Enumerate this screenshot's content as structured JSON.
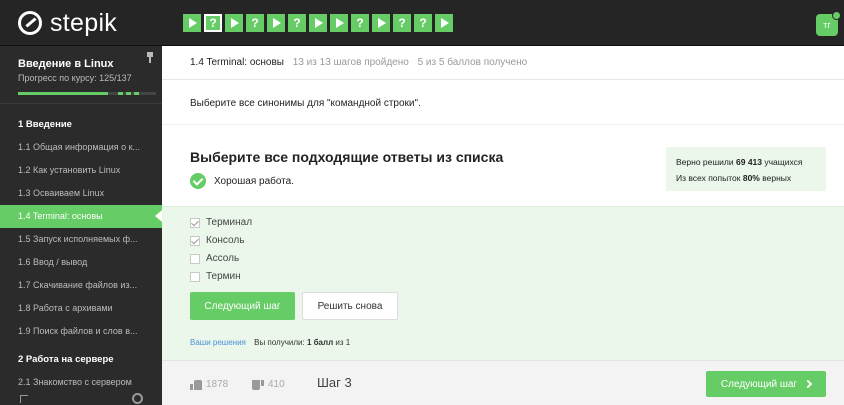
{
  "app": {
    "logo": "stepik",
    "avatar": "тг"
  },
  "steps": [
    {
      "kind": "tri"
    },
    {
      "kind": "q"
    },
    {
      "kind": "tri"
    },
    {
      "kind": "q"
    },
    {
      "kind": "tri"
    },
    {
      "kind": "q"
    },
    {
      "kind": "tri"
    },
    {
      "kind": "tri"
    },
    {
      "kind": "q"
    },
    {
      "kind": "tri"
    },
    {
      "kind": "q"
    },
    {
      "kind": "q"
    },
    {
      "kind": "tri"
    }
  ],
  "sidebar": {
    "course_title": "Введение в Linux",
    "progress_text": "Прогресс по курсу: 125/137",
    "progress_fraction": 0.91,
    "module1": "1 Введение",
    "lessons": [
      "1.1 Общая информация о к...",
      "1.2 Как установить Linux",
      "1.3 Осваиваем Linux",
      "1.4 Terminal: основы",
      "1.5 Запуск исполняемых ф...",
      "1.6 Ввод / вывод",
      "1.7 Скачивание файлов из...",
      "1.8 Работа с архивами",
      "1.9 Поиск файлов и слов в..."
    ],
    "module2": "2 Работа на сервере",
    "lesson2_1": "2.1 Знакомство с сервером"
  },
  "lesson": {
    "name": "1.4 Terminal: основы",
    "steps_done": "13 из 13 шагов пройдено",
    "points": "5 из 5 баллов  получено"
  },
  "question": "Выберите все синонимы для \"командной строки\".",
  "task": {
    "title": "Выберите все подходящие ответы из списка",
    "feedback": "Хорошая работа.",
    "stats_line1_prefix": "Верно решили ",
    "stats_line1_count": "69 413",
    "stats_line1_suffix": " учащихся",
    "stats_line2_prefix": "Из всех попыток ",
    "stats_line2_percent": "80%",
    "stats_line2_suffix": " верных"
  },
  "options": [
    {
      "label": "Терминал",
      "checked": true
    },
    {
      "label": "Консоль",
      "checked": true
    },
    {
      "label": "Ассоль",
      "checked": false
    },
    {
      "label": "Термин",
      "checked": false
    }
  ],
  "buttons": {
    "next": "Следующий шаг",
    "retry": "Решить снова",
    "next_footer": "Следующий шаг"
  },
  "result": {
    "link": "Ваши решения",
    "got_prefix": "Вы получили: ",
    "got_value": "1 балл",
    "got_suffix": " из 1"
  },
  "footer": {
    "likes": "1878",
    "dislikes": "410",
    "step": "Шаг 3"
  }
}
